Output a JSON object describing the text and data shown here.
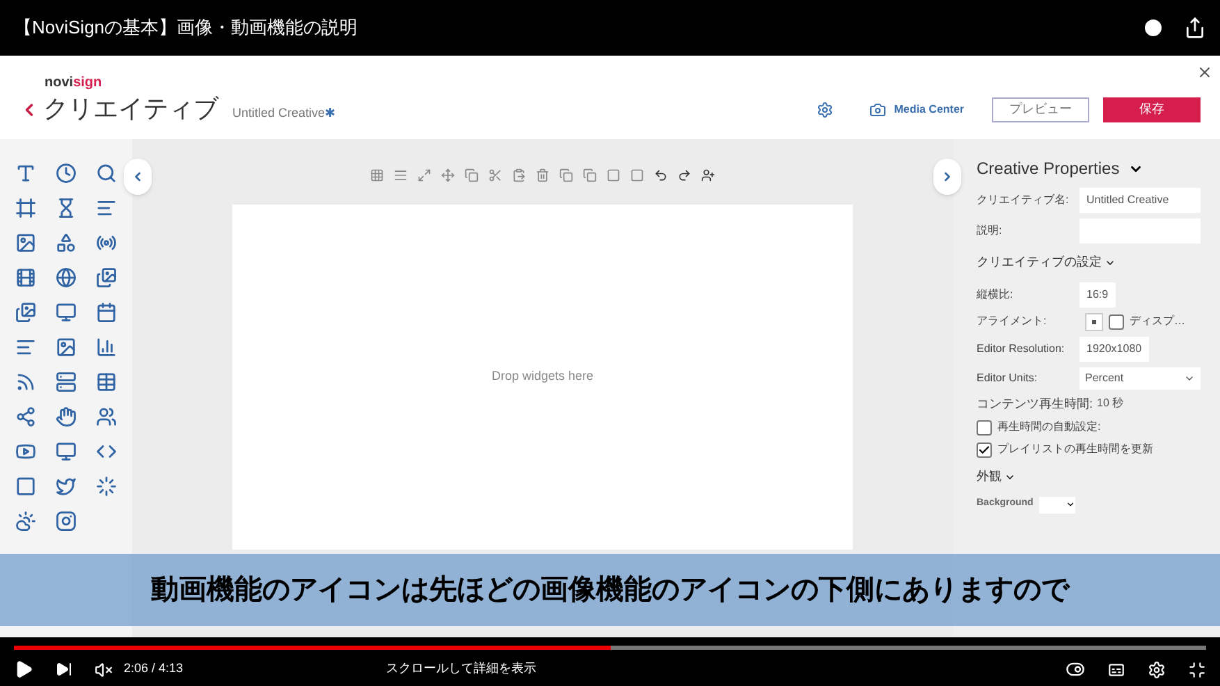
{
  "video": {
    "title": "【NoviSignの基本】画像・動画機能の説明"
  },
  "header": {
    "brand_a": "novi",
    "brand_b": "sign",
    "title": "クリエイティブ",
    "creative_name": "Untitled Creative",
    "unsaved_mark": "✱",
    "media_center": "Media Center",
    "preview": "プレビュー",
    "save": "保存"
  },
  "canvas": {
    "placeholder": "Drop widgets here"
  },
  "properties": {
    "title": "Creative Properties",
    "rows": [
      {
        "kind": "field",
        "label": "クリエイティブ名:",
        "value": "Untitled Creative"
      },
      {
        "kind": "field",
        "label": "説明:"
      },
      {
        "kind": "section",
        "label": "クリエイティブの設定"
      },
      {
        "kind": "small",
        "label": "縦横比:",
        "value": "16:9"
      },
      {
        "kind": "align",
        "label": "アライメント:",
        "option": "ディスプ…",
        "checked": false
      },
      {
        "kind": "small",
        "label": "Editor Resolution:",
        "value": "1920x1080"
      },
      {
        "kind": "select",
        "label": "Editor Units:",
        "value": "Percent"
      },
      {
        "kind": "text",
        "label": "コンテンツ再生時間:",
        "value": "10 秒"
      },
      {
        "kind": "check",
        "label": "再生時間の自動設定:",
        "checked": false
      },
      {
        "kind": "check",
        "label": "プレイリストの再生時間を更新",
        "checked": true
      },
      {
        "kind": "section",
        "label": "外観"
      },
      {
        "kind": "select_small",
        "label": "Background"
      }
    ]
  },
  "subtitle": "動画機能のアイコンは先ほどの画像機能のアイコンの下側にありますので",
  "player": {
    "time": "2:06 / 4:13",
    "level": 0.5,
    "hint": "スクロールして詳細を表示"
  }
}
